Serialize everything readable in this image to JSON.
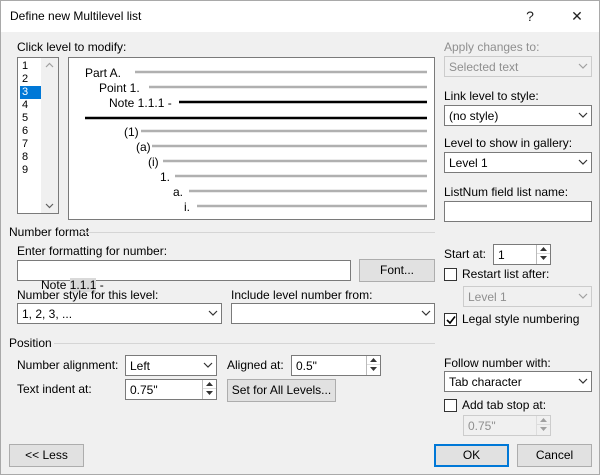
{
  "window": {
    "title": "Define new Multilevel list",
    "help_glyph": "?",
    "close_glyph": "✕"
  },
  "levels": {
    "label": "Click level to modify:",
    "items": [
      "1",
      "2",
      "3",
      "4",
      "5",
      "6",
      "7",
      "8",
      "9"
    ],
    "selected": "3"
  },
  "preview": {
    "lines": [
      "Part A.",
      "Point 1.",
      "Note 1.1.1 -",
      "(1)",
      "(a)",
      "(i)",
      "1.",
      "a.",
      "i."
    ]
  },
  "apply_changes": {
    "label": "Apply changes to:",
    "value": "Selected text"
  },
  "link_level": {
    "label": "Link level to style:",
    "value": "(no style)"
  },
  "level_gallery": {
    "label": "Level to show in gallery:",
    "value": "Level 1"
  },
  "listnum": {
    "label": "ListNum field list name:",
    "value": ""
  },
  "number_format": {
    "section_label": "Number format",
    "enter_label": "Enter formatting for number:",
    "format_value": "Note 1.1.1 -",
    "format_prefix": "Note ",
    "format_field": "1.1.1",
    "format_suffix": " -",
    "font_button": "Font...",
    "style_label": "Number style for this level:",
    "style_value": "1, 2, 3, ...",
    "include_label": "Include level number from:",
    "include_value": ""
  },
  "start_at": {
    "label": "Start at:",
    "value": "1"
  },
  "restart": {
    "label": "Restart list after:",
    "checked": false,
    "value": "Level 1"
  },
  "legal": {
    "label": "Legal style numbering",
    "checked": true
  },
  "position": {
    "section_label": "Position",
    "alignment_label": "Number alignment:",
    "alignment_value": "Left",
    "aligned_at_label": "Aligned at:",
    "aligned_at_value": "0.5\"",
    "indent_label": "Text indent at:",
    "indent_value": "0.75\"",
    "set_all_button": "Set for All Levels..."
  },
  "follow": {
    "label": "Follow number with:",
    "value": "Tab character"
  },
  "tab_stop": {
    "label": "Add tab stop at:",
    "checked": false,
    "value": "0.75\""
  },
  "footer": {
    "less_button": "<< Less",
    "ok_button": "OK",
    "cancel_button": "Cancel"
  },
  "colors": {
    "accent": "#0078d7",
    "disabled_text": "#8f8f8f",
    "dialog_bg": "#f0f0f0"
  }
}
